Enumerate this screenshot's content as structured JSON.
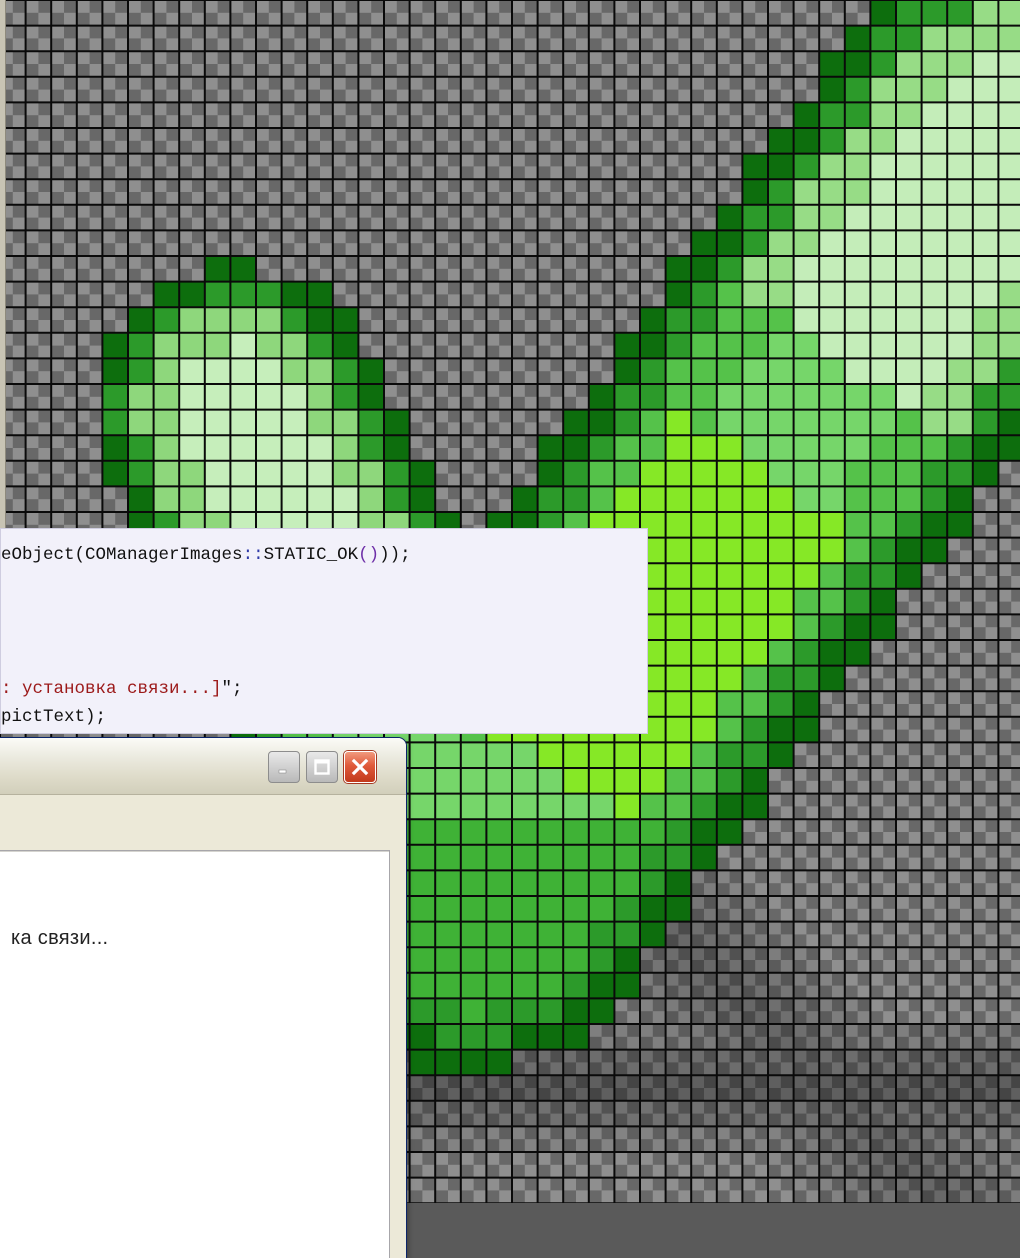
{
  "editor": {
    "artwork": "green checkmark pixel view",
    "grid": "on",
    "transparent_background": "checkerboard"
  },
  "code_snippet": {
    "line1": {
      "a": "eObject",
      "b": "(",
      "c": "COManagerImages",
      "d": "::",
      "e": "STATIC_OK",
      "f": "()",
      "g": "));"
    },
    "line2": {
      "a": ": установка связи...]",
      "b": "\";"
    },
    "line3": {
      "a": "pictText);"
    }
  },
  "window": {
    "status_text": "ка связи...",
    "buttons": {
      "minimize": "minimize-icon",
      "maximize": "maximize-icon",
      "close": "close-icon"
    }
  },
  "colors": {
    "accent_green": "#7ee21e",
    "dark_green": "#0c6e0c",
    "close_red": "#e05a3a"
  }
}
